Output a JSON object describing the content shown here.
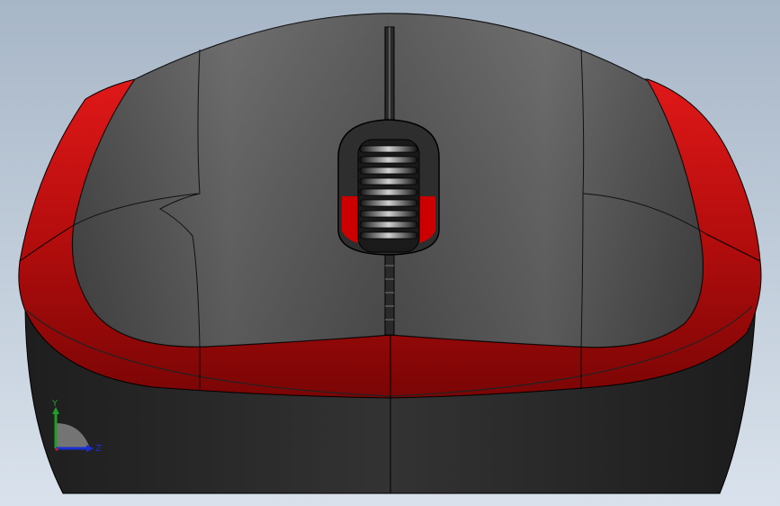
{
  "scene": {
    "background_top": "#a9b8c8",
    "background_bottom": "#d6e0ea",
    "model_colors": {
      "shell_dark": "#2c2c2c",
      "top_grey": "#5a5a5a",
      "accent_red": "#b30a0a"
    }
  },
  "triad": {
    "y_label": "Y",
    "z_label": "Z",
    "y_color": "#1f9e2a",
    "z_color": "#1a2fcf",
    "x_color": "#c81e1e"
  }
}
